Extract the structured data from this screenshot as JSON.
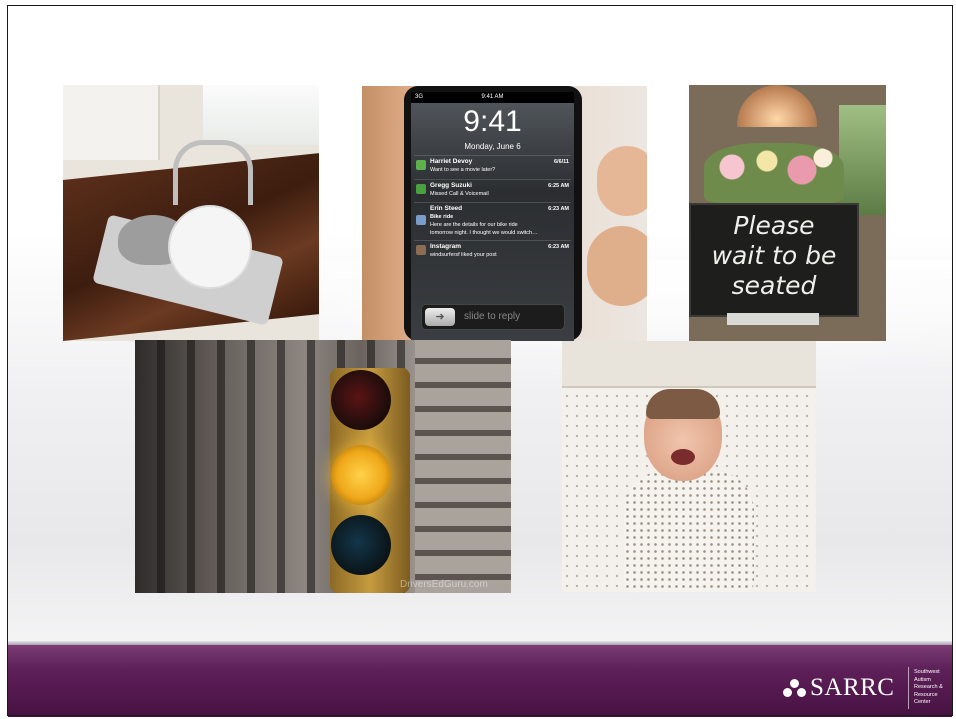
{
  "slide": {
    "background_color": "#ffffff",
    "footer_color": "#5d1f58"
  },
  "photos": {
    "kitchen": {
      "icon": "kitchen-sink-photo"
    },
    "phone": {
      "icon": "phone-notifications-photo",
      "status_carrier": "3G",
      "status_time": "9:41 AM",
      "lock_time": "9:41",
      "lock_date": "Monday, June 6",
      "notifications": [
        {
          "name": "Harriet Devoy",
          "time": "6/6/11",
          "body": "Want to see a movie later?",
          "icon_color": "#5cb14d"
        },
        {
          "name": "Gregg Suzuki",
          "time": "6:25 AM",
          "body": "Missed Call & Voicemail",
          "icon_color": "#4aa03e"
        },
        {
          "name": "Erin Steed",
          "time": "6:23 AM",
          "body": "Bike ride",
          "body2": "Here are the details for our bike ride",
          "body3": "tomorrow night. I thought we would switch…",
          "icon_color": "#7a9cc8"
        },
        {
          "name": "Instagram",
          "time": "6:23 AM",
          "body": "windsurfersf liked your post",
          "icon_color": "#8a6d52"
        }
      ],
      "slider_label": "slide to reply"
    },
    "sign": {
      "icon": "please-wait-sign-photo",
      "line1": "Please",
      "line2": "wait to be",
      "line3": "seated"
    },
    "traffic": {
      "icon": "traffic-light-photo",
      "watermark": "DriversEdGuru.com"
    },
    "baby": {
      "icon": "crying-baby-photo"
    }
  },
  "footer": {
    "logo_text": "SARRC",
    "logo_sub": [
      "Southwest",
      "Autism",
      "Research &",
      "Resource",
      "Center"
    ]
  }
}
